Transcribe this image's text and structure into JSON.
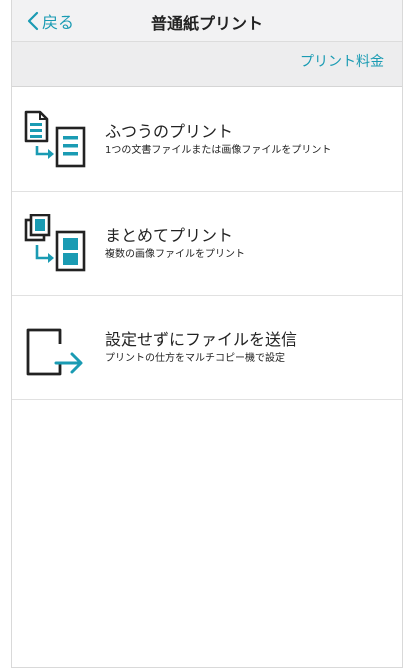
{
  "nav": {
    "back_label": "戻る",
    "title": "普通紙プリント"
  },
  "subbar": {
    "fee_link": "プリント料金"
  },
  "items": [
    {
      "title": "ふつうのプリント",
      "desc": "1つの文書ファイルまたは画像ファイルをプリント",
      "icon": "document-print-icon"
    },
    {
      "title": "まとめてプリント",
      "desc": "複数の画像ファイルをプリント",
      "icon": "multi-image-print-icon"
    },
    {
      "title": "設定せずにファイルを送信",
      "desc": "プリントの仕方をマルチコピー機で設定",
      "icon": "send-file-icon"
    }
  ],
  "colors": {
    "accent": "#1a9bb3",
    "icon_dark": "#222222",
    "nav_bg": "#f2f2f3",
    "subbar_bg": "#ededee"
  }
}
